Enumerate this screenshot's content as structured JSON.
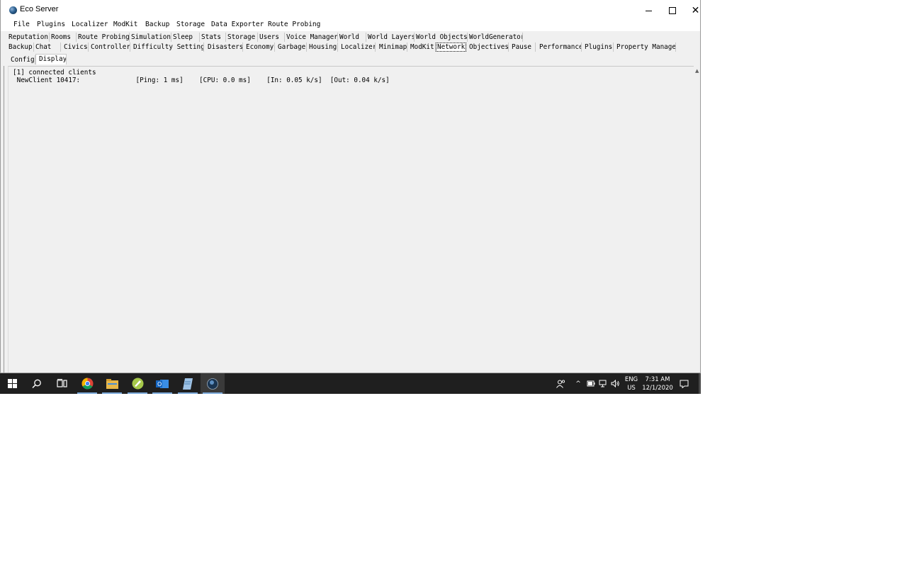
{
  "window": {
    "title": "Eco Server"
  },
  "menu": [
    "File",
    "Plugins",
    "Localizer",
    "ModKit",
    "Backup",
    "Storage",
    "Data Exporter",
    "Route Probing"
  ],
  "tabs_row1": [
    "Reputation",
    "Rooms",
    "Route Probing",
    "Simulation",
    "Sleep",
    "Stats",
    "Storage",
    "Users",
    "Voice Manager",
    "World",
    "World Layers",
    "World Objects",
    "WorldGenerator"
  ],
  "tabs_row2": [
    "Backup",
    "Chat",
    "Civics",
    "Controller",
    "Difficulty Settings",
    "Disasters",
    "Economy",
    "Garbage",
    "Housing",
    "Localizer",
    "Minimap",
    "ModKit",
    "Network",
    "Objectives",
    "Pause",
    "Performance",
    "Plugins",
    "Property Manager"
  ],
  "selected_tab": "Network",
  "subtabs": [
    "Config",
    "Display"
  ],
  "selected_subtab": "Display",
  "output": {
    "line1": "[1] connected clients",
    "line2": " NewClient 10417:              [Ping: 1 ms]    [CPU: 0.0 ms]    [In: 0.05 k/s]  [Out: 0.04 k/s]"
  },
  "taskbar": {
    "apps": [
      "start-icon",
      "search-icon",
      "task-view-icon",
      "chrome-icon",
      "file-explorer-icon",
      "app-icon",
      "outlook-icon",
      "notepad-icon",
      "eco-server-icon"
    ],
    "language": "ENG",
    "region": "US",
    "time": "7:31 AM",
    "date": "12/1/2020"
  }
}
